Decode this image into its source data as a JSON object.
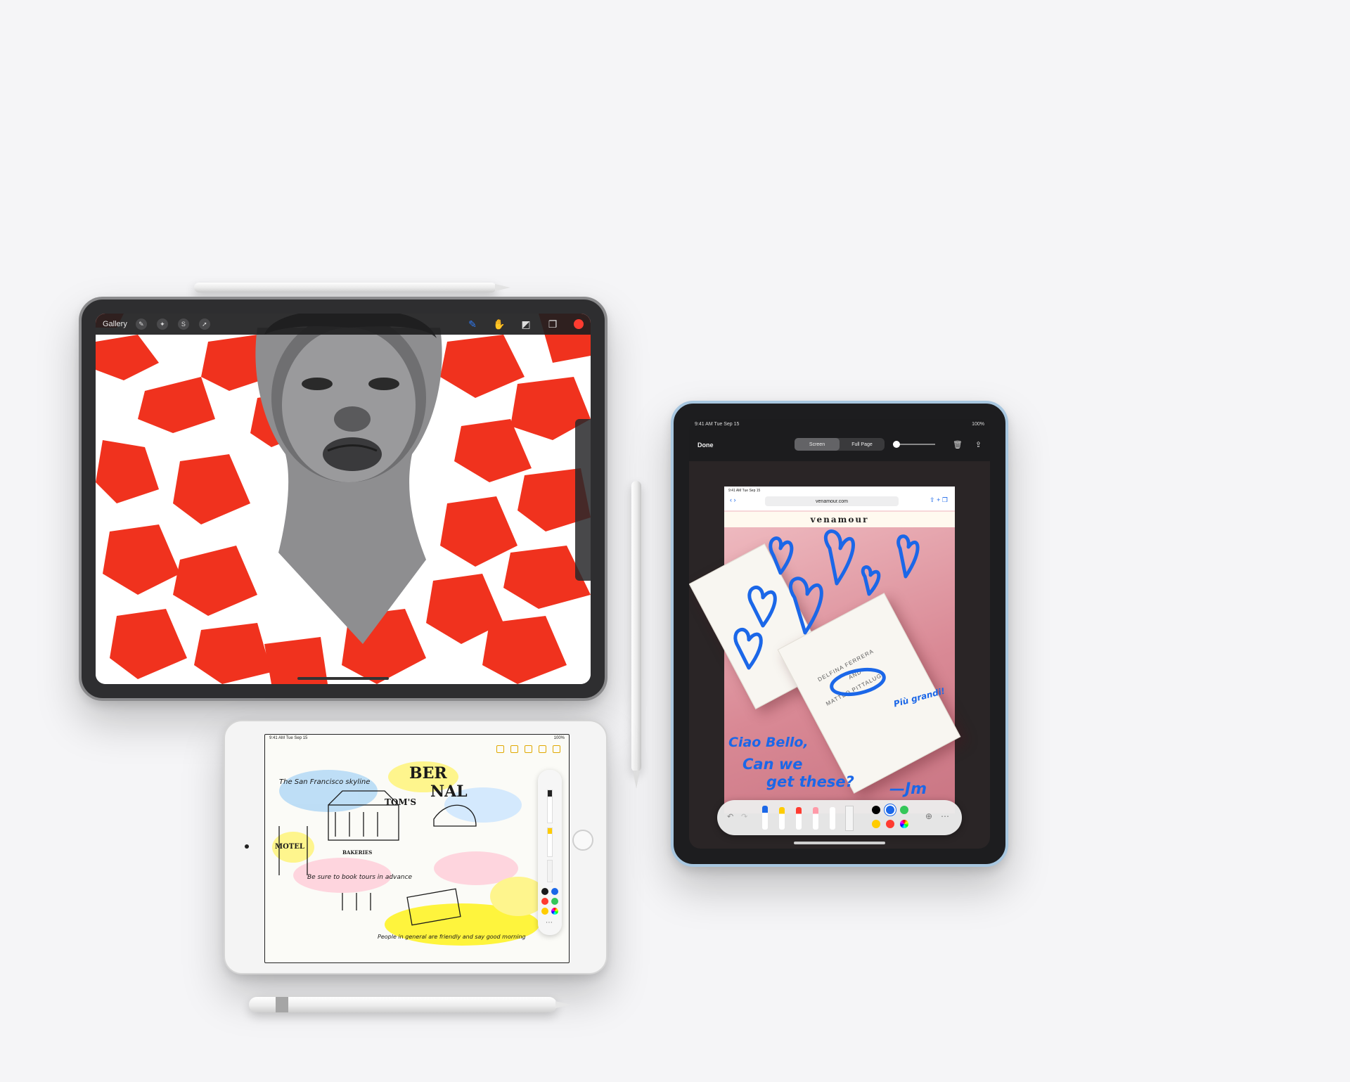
{
  "background_color": "#f5f5f7",
  "ipad_pro": {
    "app": {
      "gallery_label": "Gallery",
      "accent_color": "#ff3b30"
    }
  },
  "ipad_mini": {
    "status_time": "9:41 AM  Tue Sep 15",
    "status_battery": "100%",
    "notes": {
      "title_word_1": "BER",
      "title_word_2": "NAL",
      "sign_text": "MOTEL",
      "label_toms": "TOM'S",
      "label_bakeries": "BAKERIES",
      "note_1": "The San Francisco skyline",
      "note_2": "Be sure to book tours in advance",
      "note_3": "People in general are friendly and say good morning"
    }
  },
  "ipad_air": {
    "status_time": "9:41 AM  Tue Sep 15",
    "status_battery": "100%",
    "done_label": "Done",
    "segment_screen": "Screen",
    "segment_fullpage": "Full Page",
    "safari": {
      "status_time": "9:41 AM  Tue Sep 15",
      "url": "venamour.com",
      "brand": "venamour"
    },
    "card": {
      "line_1": "DELFINA FERRERA",
      "line_2": "AND",
      "line_3": "MATTEO PITTALUGA"
    },
    "handwriting": {
      "line_1": "Ciao Bello,",
      "line_2": "Can we",
      "line_3": "get these?",
      "side_note": "Più grandi!",
      "signature": "—Jm"
    },
    "swatch_colors": [
      "#000000",
      "#1b67e8",
      "#34c759",
      "#ffcc00",
      "#ff3b30"
    ]
  }
}
